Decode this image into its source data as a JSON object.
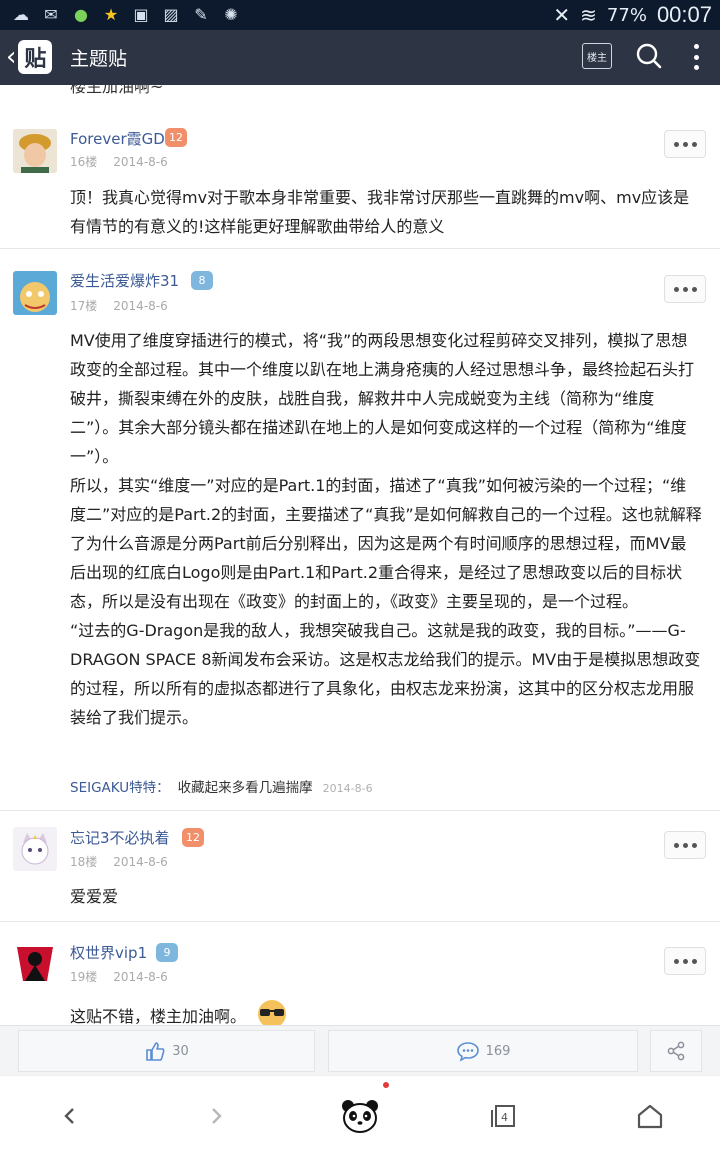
{
  "status_bar": {
    "battery": "77%",
    "time": "00:07",
    "icons": [
      "weather-icon",
      "chat-icon",
      "globe-icon",
      "star-icon",
      "sim-icon",
      "gallery-icon",
      "leaf-icon",
      "fire-icon",
      "mute-icon",
      "wifi-icon"
    ]
  },
  "header": {
    "logo_text": "贴",
    "title": "主题贴",
    "louzhu_label": "楼主"
  },
  "feed": {
    "cut_text": "楼主加油啊~",
    "posts": [
      {
        "username": "Forever霞GD",
        "level": "12",
        "floor": "16楼",
        "date": "2014-8-6",
        "text": "顶！我真心觉得mv对于歌本身非常重要、我非常讨厌那些一直跳舞的mv啊、mv应该是有情节的有意义的!这样能更好理解歌曲带给人的意义"
      },
      {
        "username": "爱生活爱爆炸31",
        "level": "8",
        "floor": "17楼",
        "date": "2014-8-6",
        "paragraphs": [
          "MV使用了维度穿插进行的模式，将“我”的两段思想变化过程剪碎交叉排列，模拟了思想政变的全部过程。其中一个维度以趴在地上满身疮痍的人经过思想斗争，最终捡起石头打破井，撕裂束缚在外的皮肤，战胜自我，解救井中人完成蜕变为主线（简称为“维度二”）。其余大部分镜头都在描述趴在地上的人是如何变成这样的一个过程（简称为“维度一”）。",
          "所以，其实“维度一”对应的是Part.1的封面，描述了“真我”如何被污染的一个过程；“维度二”对应的是Part.2的封面，主要描述了“真我”是如何解救自己的一个过程。这也就解释了为什么音源是分两Part前后分别释出，因为这是两个有时间顺序的思想过程，而MV最后出现的红底白Logo则是由Part.1和Part.2重合得来，是经过了思想政变以后的目标状态，所以是没有出现在《政变》的封面上的，《政变》主要呈现的，是一个过程。",
          "“过去的G-Dragon是我的敌人，我想突破我自己。这就是我的政变，我的目标。”——G-DRAGON SPACE 8新闻发布会采访。这是权志龙给我们的提示。MV由于是模拟思想政变的过程，所以所有的虚拟态都进行了具象化，由权志龙来扮演，这其中的区分权志龙用服装给了我们提示。"
        ],
        "reply": {
          "user": "SEIGAKU特特：",
          "text": "收藏起来多看几遍揣摩",
          "date": "2014-8-6"
        }
      },
      {
        "username": "忘记3不必执着",
        "level": "12",
        "floor": "18楼",
        "date": "2014-8-6",
        "text": "爱爱爱"
      },
      {
        "username": "权世界vip1",
        "level": "9",
        "floor": "19楼",
        "date": "2014-8-6",
        "text": "这贴不错，楼主加油啊。"
      }
    ]
  },
  "action_bar": {
    "likes": "30",
    "comments": "169"
  },
  "colors": {
    "header_bg": "#2d3443",
    "username": "#3c5a96",
    "level_orange": "#f08f6a",
    "level_blue": "#7fb6de"
  }
}
